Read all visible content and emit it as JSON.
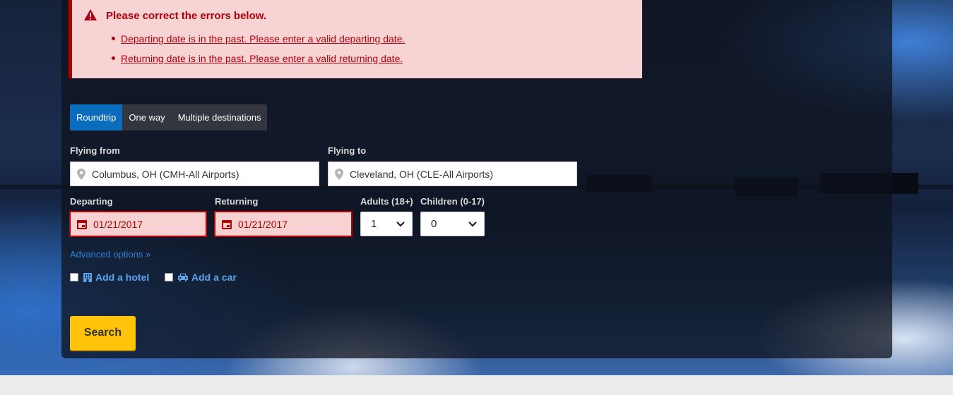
{
  "errors": {
    "title": "Please correct the errors below.",
    "items": [
      "Departing date is in the past. Please enter a valid departing date.",
      "Returning date is in the past. Please enter a valid returning date."
    ]
  },
  "trip_tabs": [
    {
      "label": "Roundtrip",
      "active": true
    },
    {
      "label": "One way",
      "active": false
    },
    {
      "label": "Multiple destinations",
      "active": false
    }
  ],
  "flying_from": {
    "label": "Flying from",
    "value": "Columbus, OH (CMH-All Airports)"
  },
  "flying_to": {
    "label": "Flying to",
    "value": "Cleveland, OH (CLE-All Airports)"
  },
  "departing": {
    "label": "Departing",
    "value": "01/21/2017"
  },
  "returning": {
    "label": "Returning",
    "value": "01/21/2017"
  },
  "adults": {
    "label": "Adults (18+)",
    "value": "1"
  },
  "children": {
    "label": "Children (0-17)",
    "value": "0"
  },
  "advanced_options": "Advanced options »",
  "add_hotel": {
    "label": "Add a hotel",
    "checked": false
  },
  "add_car": {
    "label": "Add a car",
    "checked": false
  },
  "search_button": "Search",
  "colors": {
    "error_text": "#b0000b",
    "error_bg": "#f8d3d4",
    "tab_active": "#0a6cbd",
    "link": "#5aa4ee",
    "search_button": "#ffc40a"
  },
  "icons": {
    "error": "warning-triangle-icon",
    "location": "map-pin-icon",
    "date": "calendar-icon",
    "hotel": "hotel-building-icon",
    "car": "car-icon",
    "select": "chevron-down-icon"
  }
}
